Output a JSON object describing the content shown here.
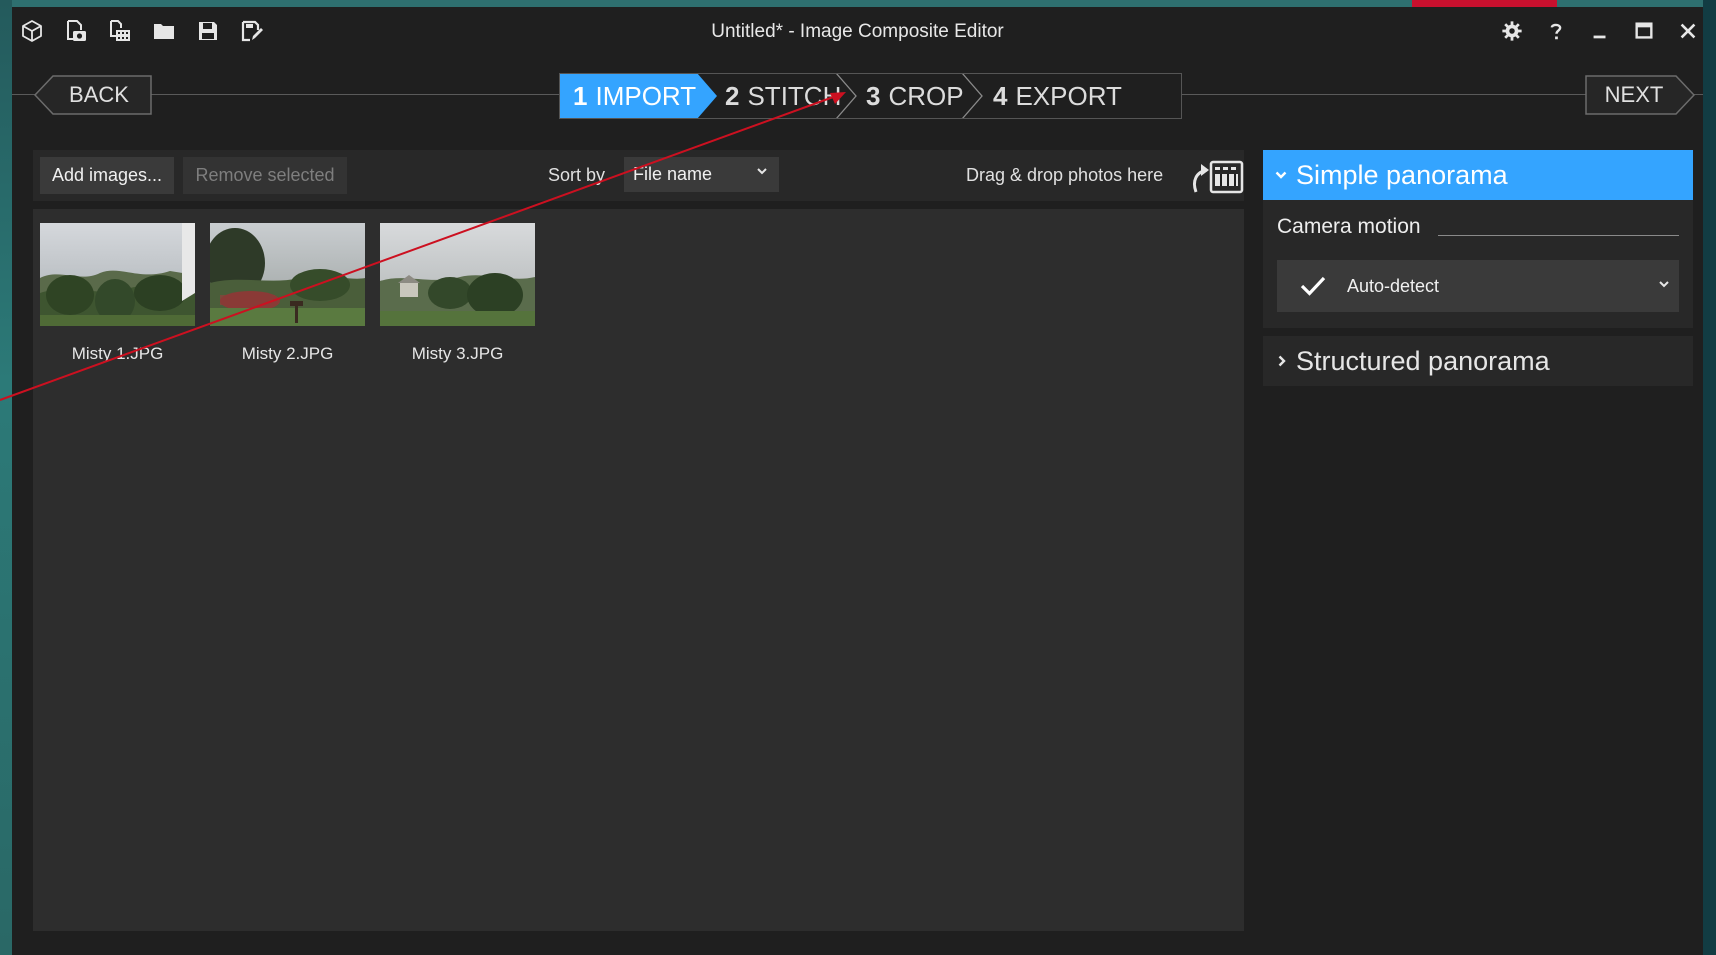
{
  "window": {
    "title": "Untitled* - Image Composite Editor"
  },
  "quick_access": {
    "icons": [
      "app-cube-icon",
      "new-panorama-icon",
      "new-video-panorama-icon",
      "open-folder-icon",
      "save-icon",
      "save-as-icon"
    ]
  },
  "window_controls": {
    "icons": [
      "gear-icon",
      "help-icon",
      "minimize-icon",
      "maximize-icon",
      "close-icon"
    ]
  },
  "wizard": {
    "back_label": "BACK",
    "next_label": "NEXT",
    "steps": [
      {
        "number": "1",
        "label": "IMPORT",
        "active": true
      },
      {
        "number": "2",
        "label": "STITCH",
        "active": false
      },
      {
        "number": "3",
        "label": "CROP",
        "active": false
      },
      {
        "number": "4",
        "label": "EXPORT",
        "active": false
      }
    ]
  },
  "import_toolbar": {
    "add_images_label": "Add images...",
    "remove_selected_label": "Remove selected",
    "sort_by_label": "Sort by",
    "sort_by_value": "File name",
    "drop_hint": "Drag & drop photos here"
  },
  "images": [
    {
      "caption": "Misty 1.JPG"
    },
    {
      "caption": "Misty 2.JPG"
    },
    {
      "caption": "Misty 3.JPG"
    }
  ],
  "panel": {
    "simple_panorama_label": "Simple panorama",
    "camera_motion_label": "Camera motion",
    "camera_motion_value": "Auto-detect",
    "structured_panorama_label": "Structured panorama"
  },
  "colors": {
    "accent_blue": "#34a4ff",
    "annotation_red": "#c8102e",
    "window_bg": "#1f1f1f"
  }
}
